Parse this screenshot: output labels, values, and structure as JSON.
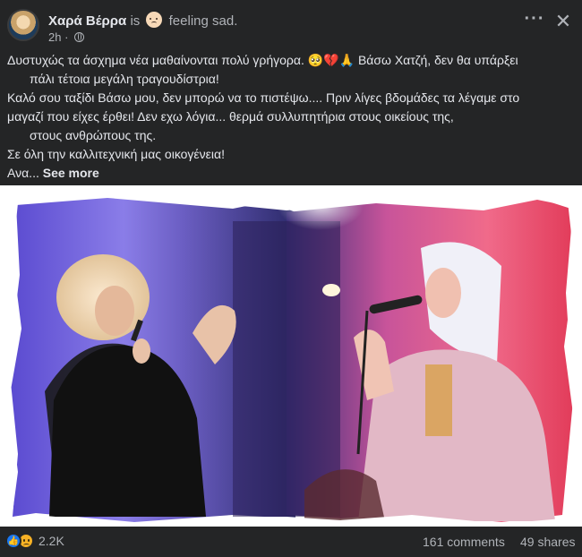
{
  "post": {
    "author": "Χαρά Βέρρα",
    "is_text": "is",
    "feeling_text": "feeling sad.",
    "time": "2h",
    "lines": [
      "Δυστυχώς τα άσχημα νέα μαθαίνονται πολύ γρήγορα. 🥺💔🙏 Βάσω Χατζή, δεν θα υπάρξει",
      "πάλι τέτοια μεγάλη τραγουδίστρια!",
      "Καλό σου ταξίδι Βάσω μου, δεν μπορώ να το πιστέψω.... Πριν λίγες βδομάδες τα λέγαμε στο",
      "μαγαζί που είχες έρθει! Δεν εχω λόγια... θερμά συλλυπητήρια στους οικείους της,",
      "στους ανθρώπους της.",
      "Σε όλη την καλλιτεχνική μας οικογένεια!"
    ],
    "truncated_prefix": "Ανα...",
    "see_more": "See more"
  },
  "icons": {
    "more": "more-options-icon",
    "close": "close-icon",
    "privacy": "globe-icon",
    "feeling": "feeling-sad-emoji-icon",
    "like": "like-reaction-icon",
    "sad": "sad-reaction-icon"
  },
  "stats": {
    "reaction_count": "2.2K",
    "comments": "161 comments",
    "shares": "49 shares"
  },
  "colors": {
    "background": "#242526",
    "text": "#e4e6eb",
    "muted": "#b0b3b8",
    "like_blue": "#1877f2",
    "sad_yellow": "#f7b125"
  }
}
